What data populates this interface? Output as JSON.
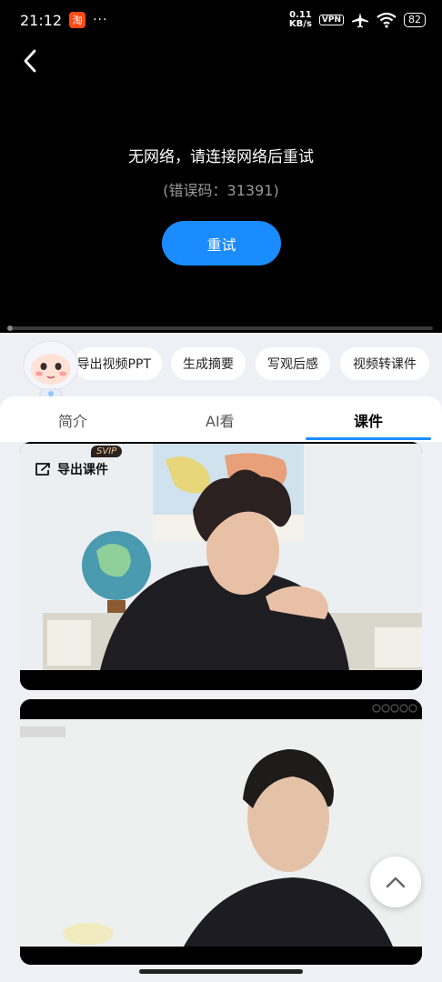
{
  "status_bar": {
    "time": "21:12",
    "speed_value": "0.11",
    "speed_unit": "KB/s",
    "vpn": "VPN",
    "battery": "82",
    "more": "···",
    "taobao": "淘"
  },
  "player": {
    "error_title": "无网络，请连接网络后重试",
    "error_code": "(错误码：31391)",
    "retry_label": "重试"
  },
  "actions": {
    "chips": [
      "导出视频PPT",
      "生成摘要",
      "写观后感",
      "视频转课件"
    ]
  },
  "tabs": {
    "items": [
      "简介",
      "AI看",
      "课件"
    ],
    "active_index": 2
  },
  "courseware": {
    "export_label": "导出课件",
    "svip_badge": "SVIP"
  },
  "colors": {
    "accent": "#1a8cff",
    "background": "#eef0f6"
  }
}
